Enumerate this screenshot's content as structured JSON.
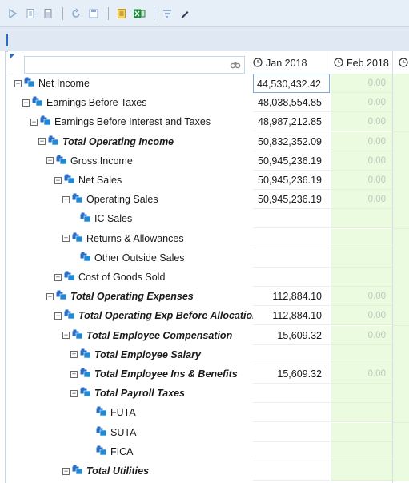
{
  "toolbar": {
    "icons": [
      "play-icon",
      "document-icon",
      "calculator-icon",
      "refresh-icon",
      "save-icon",
      "note-icon",
      "excel-icon",
      "filter-icon",
      "pencil-icon"
    ],
    "colors": {
      "accent": "#2b6cc4",
      "excel": "#1f8a3c",
      "note": "#e6a600"
    }
  },
  "search": {
    "placeholder": ""
  },
  "columns": [
    {
      "label": "Jan 2018"
    },
    {
      "label": "Feb 2018"
    }
  ],
  "rows": [
    {
      "label": "Net Income",
      "indent": 0,
      "expander": "minus",
      "bold": false,
      "jan": "44,530,432.42",
      "feb": "0.00",
      "selected": true
    },
    {
      "label": "Earnings Before Taxes",
      "indent": 1,
      "expander": "minus",
      "bold": false,
      "jan": "48,038,554.85",
      "feb": "0.00"
    },
    {
      "label": "Earnings Before Interest and Taxes",
      "indent": 2,
      "expander": "minus",
      "bold": false,
      "jan": "48,987,212.85",
      "feb": "0.00"
    },
    {
      "label": "Total Operating Income",
      "indent": 3,
      "expander": "minus",
      "bold": true,
      "jan": "50,832,352.09",
      "feb": "0.00"
    },
    {
      "label": "Gross Income",
      "indent": 4,
      "expander": "minus",
      "bold": false,
      "jan": "50,945,236.19",
      "feb": "0.00"
    },
    {
      "label": "Net Sales",
      "indent": 5,
      "expander": "minus",
      "bold": false,
      "jan": "50,945,236.19",
      "feb": "0.00"
    },
    {
      "label": "Operating Sales",
      "indent": 6,
      "expander": "plus",
      "bold": false,
      "jan": "50,945,236.19",
      "feb": "0.00"
    },
    {
      "label": "IC Sales",
      "indent": 7,
      "expander": "none",
      "bold": false,
      "jan": "",
      "feb": ""
    },
    {
      "label": "Returns & Allowances",
      "indent": 6,
      "expander": "plus",
      "bold": false,
      "jan": "",
      "feb": ""
    },
    {
      "label": "Other Outside Sales",
      "indent": 7,
      "expander": "none",
      "bold": false,
      "jan": "",
      "feb": ""
    },
    {
      "label": "Cost of Goods Sold",
      "indent": 5,
      "expander": "plus",
      "bold": false,
      "jan": "",
      "feb": ""
    },
    {
      "label": "Total Operating Expenses",
      "indent": 4,
      "expander": "minus",
      "bold": true,
      "jan": "112,884.10",
      "feb": "0.00"
    },
    {
      "label": "Total Operating Exp Before Allocation",
      "indent": 5,
      "expander": "minus",
      "bold": true,
      "jan": "112,884.10",
      "feb": "0.00"
    },
    {
      "label": "Total Employee Compensation",
      "indent": 6,
      "expander": "minus",
      "bold": true,
      "jan": "15,609.32",
      "feb": "0.00"
    },
    {
      "label": "Total Employee Salary",
      "indent": 7,
      "expander": "plus",
      "bold": true,
      "jan": "",
      "feb": ""
    },
    {
      "label": "Total Employee Ins & Benefits",
      "indent": 7,
      "expander": "plus",
      "bold": true,
      "jan": "15,609.32",
      "feb": "0.00"
    },
    {
      "label": "Total Payroll Taxes",
      "indent": 7,
      "expander": "minus",
      "bold": true,
      "jan": "",
      "feb": ""
    },
    {
      "label": "FUTA",
      "indent": 9,
      "expander": "none",
      "bold": false,
      "jan": "",
      "feb": ""
    },
    {
      "label": "SUTA",
      "indent": 9,
      "expander": "none",
      "bold": false,
      "jan": "",
      "feb": ""
    },
    {
      "label": "FICA",
      "indent": 9,
      "expander": "none",
      "bold": false,
      "jan": "",
      "feb": ""
    },
    {
      "label": "Total Utilities",
      "indent": 6,
      "expander": "minus",
      "bold": true,
      "jan": "",
      "feb": ""
    }
  ]
}
